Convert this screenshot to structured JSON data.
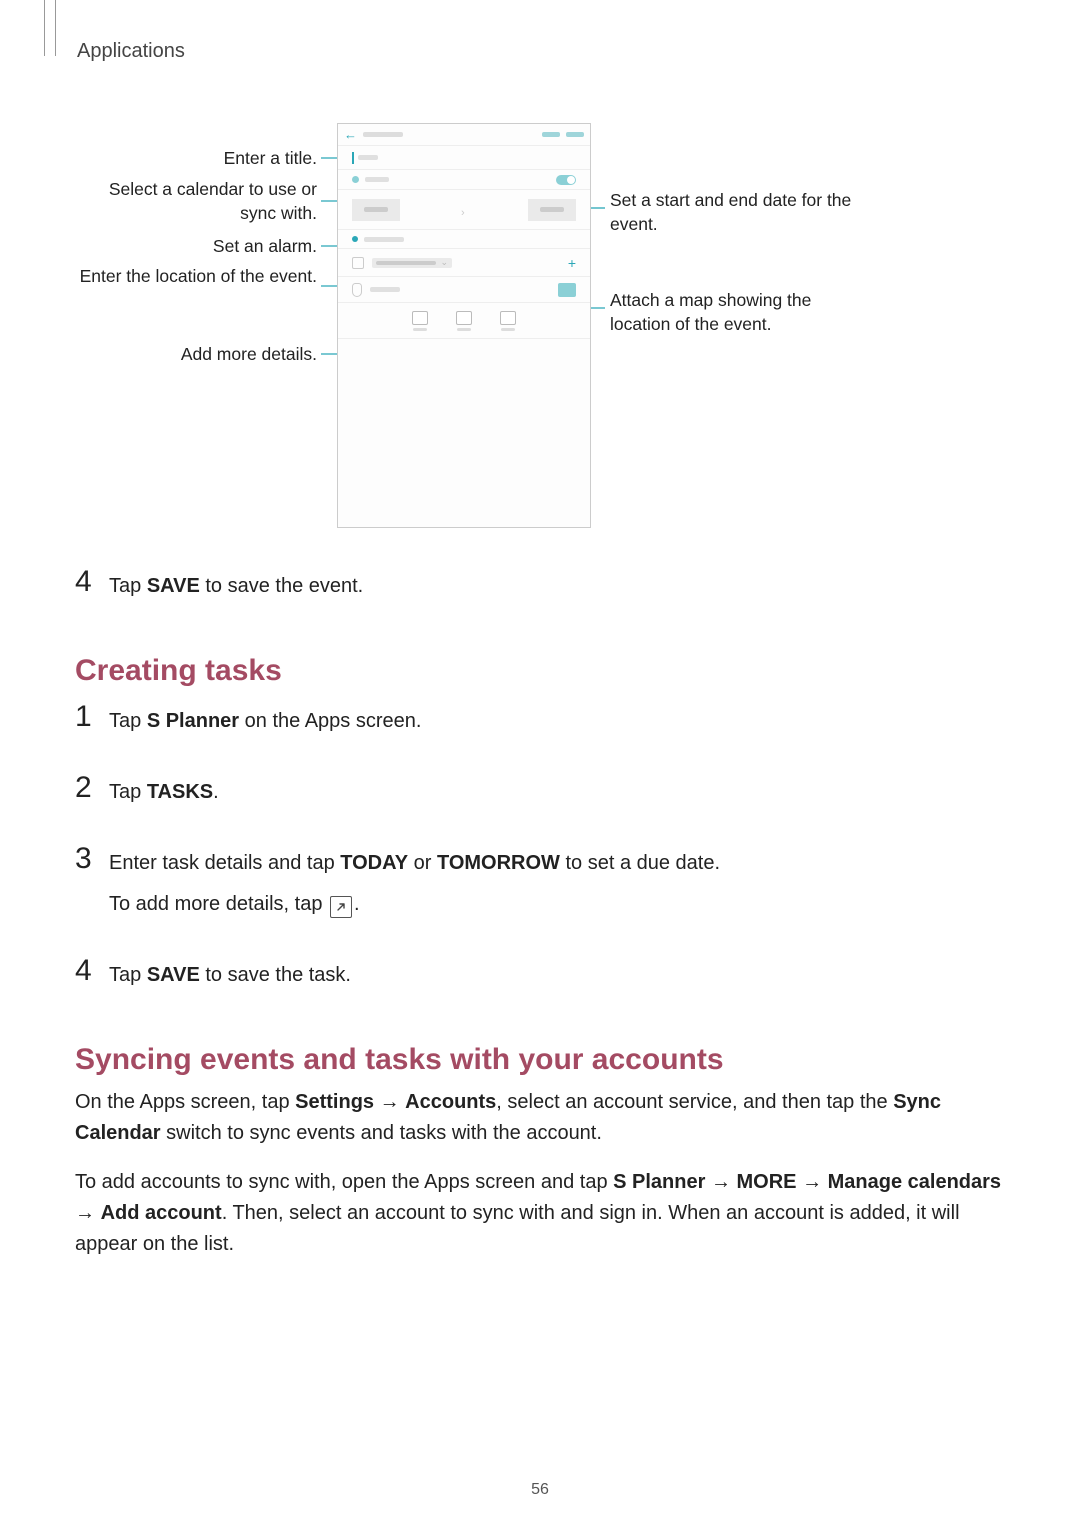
{
  "header": {
    "section": "Applications"
  },
  "diagram": {
    "left_callouts": {
      "title": "Enter a title.",
      "calendar": "Select a calendar to use or sync with.",
      "alarm": "Set an alarm.",
      "location": "Enter the location of the event.",
      "more": "Add more details."
    },
    "right_callouts": {
      "dates": "Set a start and end date for the event.",
      "map": "Attach a map showing the location of the event."
    }
  },
  "step4a": {
    "num": "4",
    "text_pre": "Tap ",
    "text_bold": "SAVE",
    "text_post": " to save the event."
  },
  "heading1": "Creating tasks",
  "tasks_steps": {
    "s1": {
      "num": "1",
      "pre": "Tap ",
      "b1": "S Planner",
      "post": " on the Apps screen."
    },
    "s2": {
      "num": "2",
      "pre": "Tap ",
      "b1": "TASKS",
      "post": "."
    },
    "s3": {
      "num": "3",
      "line1_pre": "Enter task details and tap ",
      "line1_b1": "TODAY",
      "line1_mid": " or ",
      "line1_b2": "TOMORROW",
      "line1_post": " to set a due date.",
      "line2_pre": "To add more details, tap ",
      "line2_post": "."
    },
    "s4": {
      "num": "4",
      "pre": "Tap ",
      "b1": "SAVE",
      "post": " to save the task."
    }
  },
  "heading2": "Syncing events and tasks with your accounts",
  "syncing": {
    "p1_a": "On the Apps screen, tap ",
    "p1_b1": "Settings",
    "p1_arrow1": " → ",
    "p1_b2": "Accounts",
    "p1_c": ", select an account service, and then tap the ",
    "p1_b3": "Sync Calendar",
    "p1_d": " switch to sync events and tasks with the account.",
    "p2_a": "To add accounts to sync with, open the Apps screen and tap ",
    "p2_b1": "S Planner",
    "p2_arrow1": " → ",
    "p2_b2": "MORE",
    "p2_arrow2": " → ",
    "p2_b3": "Manage calendars",
    "p2_arrow3": " → ",
    "p2_b4": "Add account",
    "p2_c": ". Then, select an account to sync with and sign in. When an account is added, it will appear on the list."
  },
  "page_number": "56"
}
